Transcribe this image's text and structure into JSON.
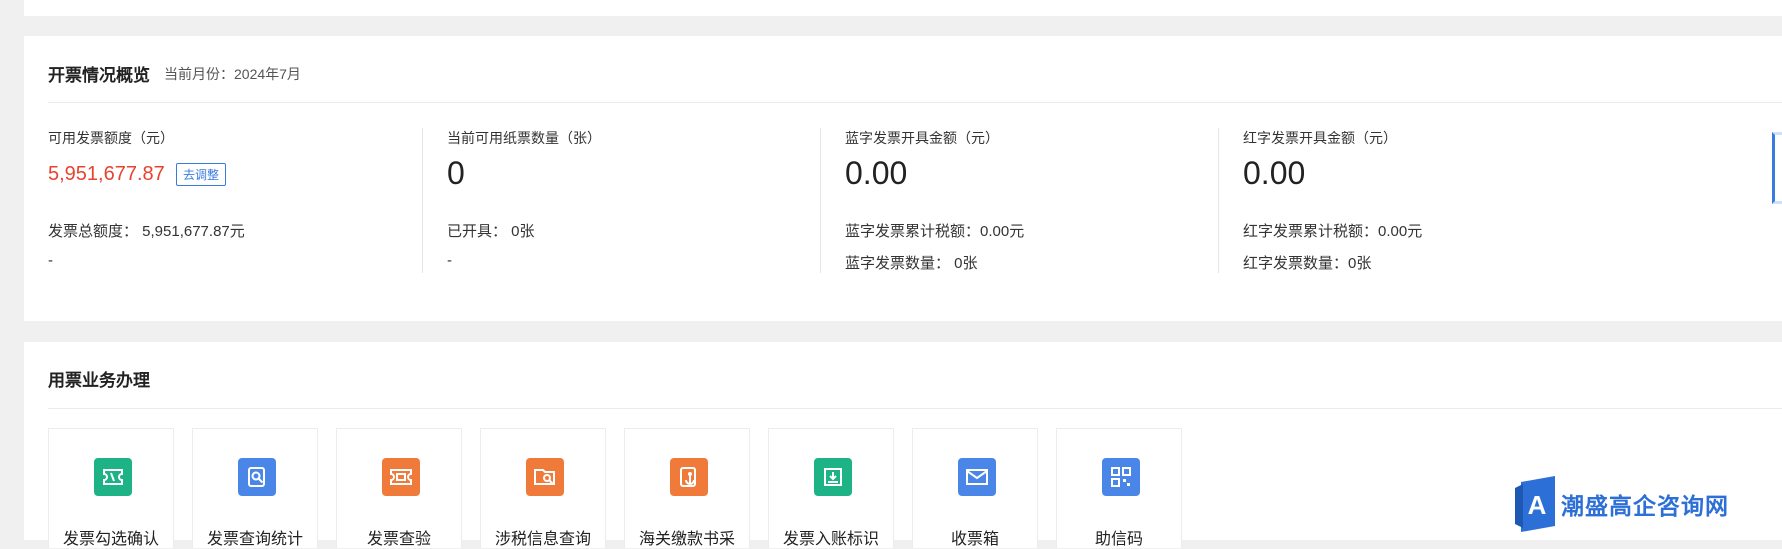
{
  "overview": {
    "title": "开票情况概览",
    "subtitle": "当前月份：2024年7月",
    "stats": [
      {
        "label": "可用发票额度（元）",
        "value": "5,951,677.87",
        "action": "去调整",
        "line1": "发票总额度： 5,951,677.87元",
        "line2": "-"
      },
      {
        "label": "当前可用纸票数量（张）",
        "value": "0",
        "line1": "已开具： 0张",
        "line2": "-"
      },
      {
        "label": "蓝字发票开具金额（元）",
        "value": "0.00",
        "line1": "蓝字发票累计税额：0.00元",
        "line2": "蓝字发票数量： 0张"
      },
      {
        "label": "红字发票开具金额（元）",
        "value": "0.00",
        "line1": "红字发票累计税额：0.00元",
        "line2": "红字发票数量：0张"
      }
    ]
  },
  "business": {
    "title": "用票业务办理",
    "tiles": [
      {
        "label": "发票勾选确认",
        "icon": "ticket-icon",
        "color": "#1db386"
      },
      {
        "label": "发票查询统计",
        "icon": "doc-search-icon",
        "color": "#4a86e8"
      },
      {
        "label": "发票查验",
        "icon": "ticket-check-icon",
        "color": "#f07a3a"
      },
      {
        "label": "涉税信息查询",
        "icon": "folder-search-icon",
        "color": "#f07a3a"
      },
      {
        "label": "海关缴款书采",
        "icon": "anchor-doc-icon",
        "color": "#f07a3a"
      },
      {
        "label": "发票入账标识",
        "icon": "inbox-download-icon",
        "color": "#1db386"
      },
      {
        "label": "收票箱",
        "icon": "mail-icon",
        "color": "#4a86e8"
      },
      {
        "label": "助信码",
        "icon": "qr-code-icon",
        "color": "#4a86e8"
      }
    ]
  },
  "watermark": {
    "text": "潮盛高企咨询网",
    "logo_letter": "A",
    "color": "#2c6fd6"
  }
}
